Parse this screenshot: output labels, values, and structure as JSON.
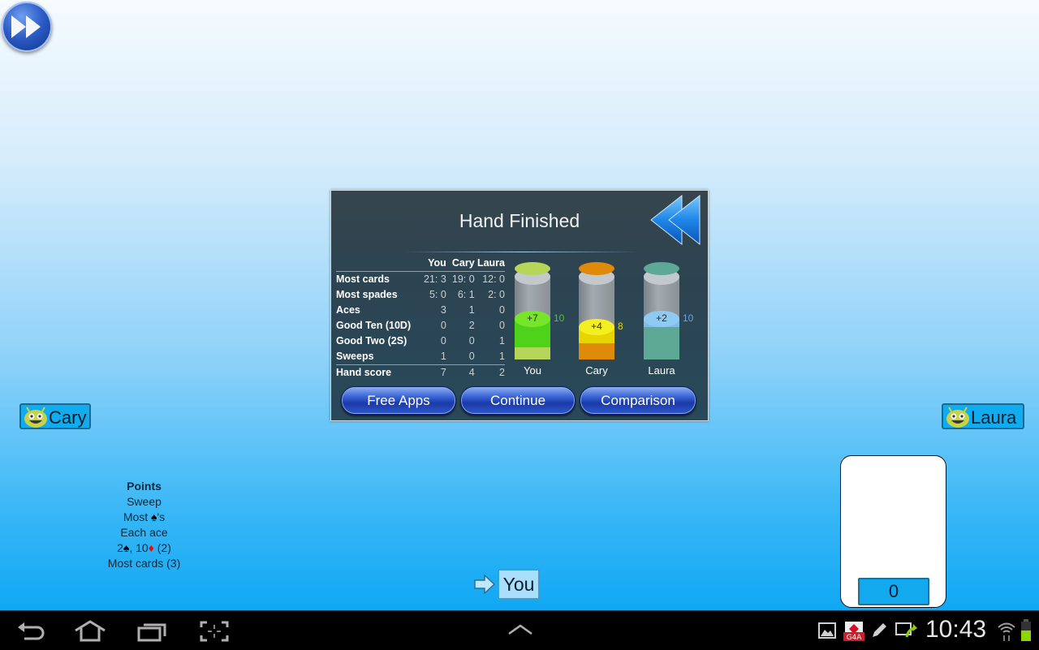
{
  "toolbar": {
    "fast_forward_icon": "fast-forward-icon"
  },
  "dialog": {
    "title": "Hand Finished",
    "back_icon": "rewind-icon",
    "table": {
      "columns": [
        "You",
        "Cary",
        "Laura"
      ],
      "rows": [
        {
          "label": "Most cards",
          "values": [
            "21: 3",
            "19: 0",
            "12: 0"
          ]
        },
        {
          "label": "Most spades",
          "values": [
            "5: 0",
            "6: 1",
            "2: 0"
          ]
        },
        {
          "label": "Aces",
          "values": [
            "3",
            "1",
            "0"
          ]
        },
        {
          "label": "Good Ten (10D)",
          "values": [
            "0",
            "2",
            "0"
          ]
        },
        {
          "label": "Good Two (2S)",
          "values": [
            "0",
            "0",
            "1"
          ]
        },
        {
          "label": "Sweeps",
          "values": [
            "1",
            "0",
            "1"
          ]
        }
      ],
      "total": {
        "label": "Hand score",
        "values": [
          "7",
          "4",
          "2"
        ]
      }
    },
    "cylinders": [
      {
        "name": "You",
        "delta": "+7",
        "total": "10",
        "prev": 3,
        "gain": 7,
        "max": 21,
        "prev_color": "#b6d65a",
        "gain_color": "#4fd21a",
        "gain_top": "#77e62a",
        "total_color": "#58c22b"
      },
      {
        "name": "Cary",
        "delta": "+4",
        "total": "8",
        "prev": 4,
        "gain": 4,
        "max": 21,
        "prev_color": "#e08a0a",
        "gain_color": "#e8d400",
        "gain_top": "#f4ef20",
        "total_color": "#e0d21a"
      },
      {
        "name": "Laura",
        "delta": "+2",
        "total": "10",
        "prev": 8,
        "gain": 2,
        "max": 21,
        "prev_color": "#5ea896",
        "gain_color": "#7fbde8",
        "gain_top": "#8fcaf2",
        "total_color": "#6aa6d6"
      }
    ],
    "buttons": {
      "free_apps": "Free Apps",
      "continue": "Continue",
      "comparison": "Comparison"
    }
  },
  "players": {
    "left": {
      "name": "Cary"
    },
    "right": {
      "name": "Laura"
    },
    "self": {
      "name": "You"
    }
  },
  "points_legend": {
    "title": "Points",
    "lines": [
      "Sweep",
      "Most",
      "'s",
      "Each ace",
      "2",
      ", 10",
      " (2)",
      "Most cards (3)"
    ],
    "spade_glyph": "♠",
    "diamond_glyph": "♦"
  },
  "pile": {
    "count": "0"
  },
  "status_bar": {
    "time": "10:43",
    "battery_color": "#8fd400"
  }
}
